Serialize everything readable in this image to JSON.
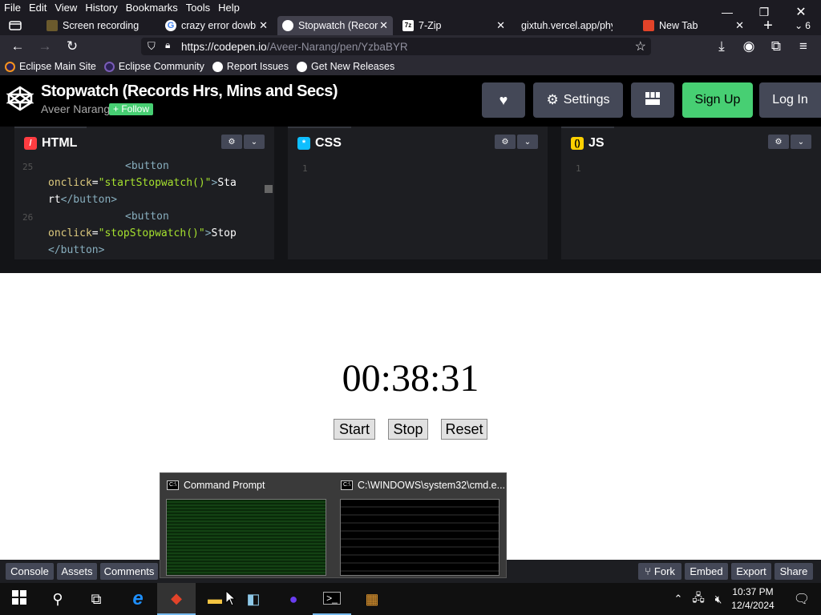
{
  "menubar": {
    "items": [
      "File",
      "Edit",
      "View",
      "History",
      "Bookmarks",
      "Tools",
      "Help"
    ]
  },
  "tabs": [
    {
      "label": "Screen recording",
      "icon": "screen-recording-icon"
    },
    {
      "label": "crazy error dowbl",
      "icon": "google-icon"
    },
    {
      "label": "Stopwatch (Recor",
      "icon": "codepen-icon",
      "active": true
    },
    {
      "label": "7-Zip",
      "icon": "7zip-icon"
    },
    {
      "label": "gixtuh.vercel.app/phy",
      "icon": ""
    },
    {
      "label": "New Tab",
      "icon": "gitlab-icon"
    }
  ],
  "tab_overflow_count": "6",
  "navbar": {
    "url_host": "https://codepen.io",
    "url_path": "/Aveer-Narang/pen/YzbaBYR"
  },
  "bookmarks": [
    {
      "label": "Eclipse Main Site",
      "icon": "eclipse-icon"
    },
    {
      "label": "Eclipse Community",
      "icon": "eclipse-icon"
    },
    {
      "label": "Report Issues",
      "icon": "github-icon"
    },
    {
      "label": "Get New Releases",
      "icon": "github-icon"
    }
  ],
  "codepen": {
    "title": "Stopwatch (Records Hrs, Mins and Secs)",
    "author": "Aveer Narang",
    "follow_label": "+ Follow",
    "settings_label": "Settings",
    "signup_label": "Sign Up",
    "login_label": "Log In"
  },
  "editors": {
    "html": {
      "label": "HTML",
      "line_a": "25",
      "line_b": "26"
    },
    "css": {
      "label": "CSS",
      "line": "1"
    },
    "js": {
      "label": "JS",
      "line": "1"
    }
  },
  "html_code": {
    "l1_tag": "<button",
    "l2_attr": "onclick",
    "l2_eq": "=",
    "l2_str": "\"startStopwatch()\"",
    "l2_gt": ">",
    "l2_text": "Sta",
    "l3_text": "rt",
    "l3_tag": "</button>",
    "l4_tag": "<button",
    "l5_attr": "onclick",
    "l5_eq": "=",
    "l5_str": "\"stopStopwatch()\"",
    "l5_gt": ">",
    "l5_text": "Stop",
    "l6_tag": "</button>"
  },
  "result": {
    "timer": "00:38:31",
    "start_label": "Start",
    "stop_label": "Stop",
    "reset_label": "Reset"
  },
  "footer": {
    "console": "Console",
    "assets": "Assets",
    "comments": "Comments",
    "fork": "Fork",
    "embed": "Embed",
    "export": "Export",
    "share": "Share"
  },
  "switcher": {
    "item1": "Command Prompt",
    "item2": "C:\\WINDOWS\\system32\\cmd.e..."
  },
  "clock": {
    "time": "10:37 PM",
    "date": "12/4/2024"
  },
  "colors": {
    "codepen_green": "#47cf73",
    "button_gray": "#444857",
    "html_red": "#ff3c41",
    "css_blue": "#0ebeff",
    "js_yellow": "#fcd000"
  }
}
